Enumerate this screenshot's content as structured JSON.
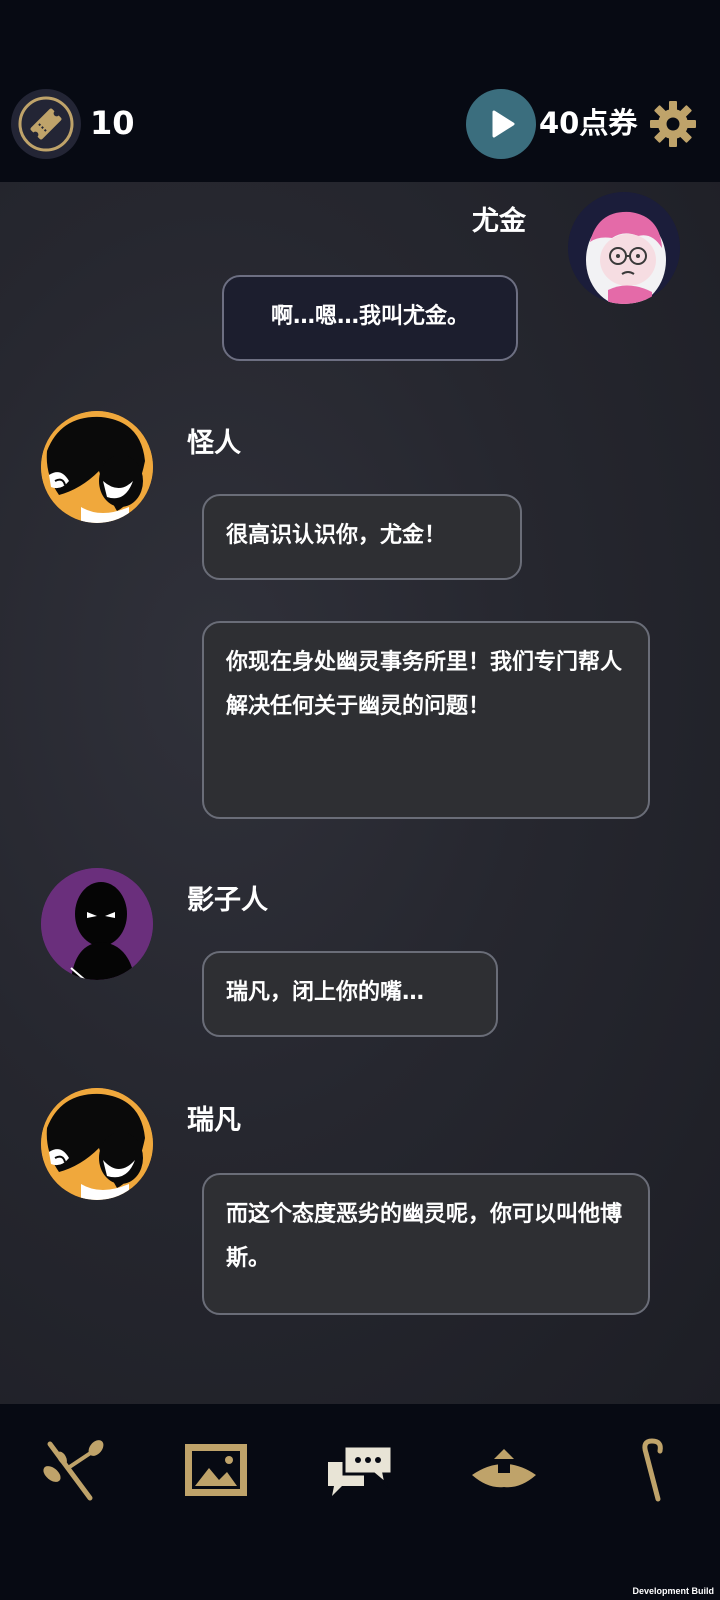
{
  "top_bar": {
    "ticket_count": "10",
    "points_label": "40点券"
  },
  "messages": [
    {
      "speaker": "尤金",
      "side": "right",
      "bubbles": [
        "啊…嗯…我叫尤金。"
      ]
    },
    {
      "speaker": "怪人",
      "side": "left",
      "bubbles": [
        "很高识认识你，尤金！",
        "你现在身处幽灵事务所里！我们专门帮人解决任何关于幽灵的问题！"
      ]
    },
    {
      "speaker": "影子人",
      "side": "left",
      "bubbles": [
        "瑞凡，闭上你的嘴…"
      ]
    },
    {
      "speaker": "瑞凡",
      "side": "left",
      "bubbles": [
        "而这个态度恶劣的幽灵呢，你可以叫他博斯。"
      ]
    }
  ],
  "bottom_nav": {
    "items": [
      "branch-icon",
      "gallery-icon",
      "chat-icon",
      "hat-icon",
      "cane-icon"
    ],
    "active": "chat-icon"
  },
  "footer": {
    "build_label": "Development Build"
  },
  "colors": {
    "accent_gold": "#bfa36a",
    "play_teal": "#3b6e7e",
    "background": "#070a13"
  }
}
